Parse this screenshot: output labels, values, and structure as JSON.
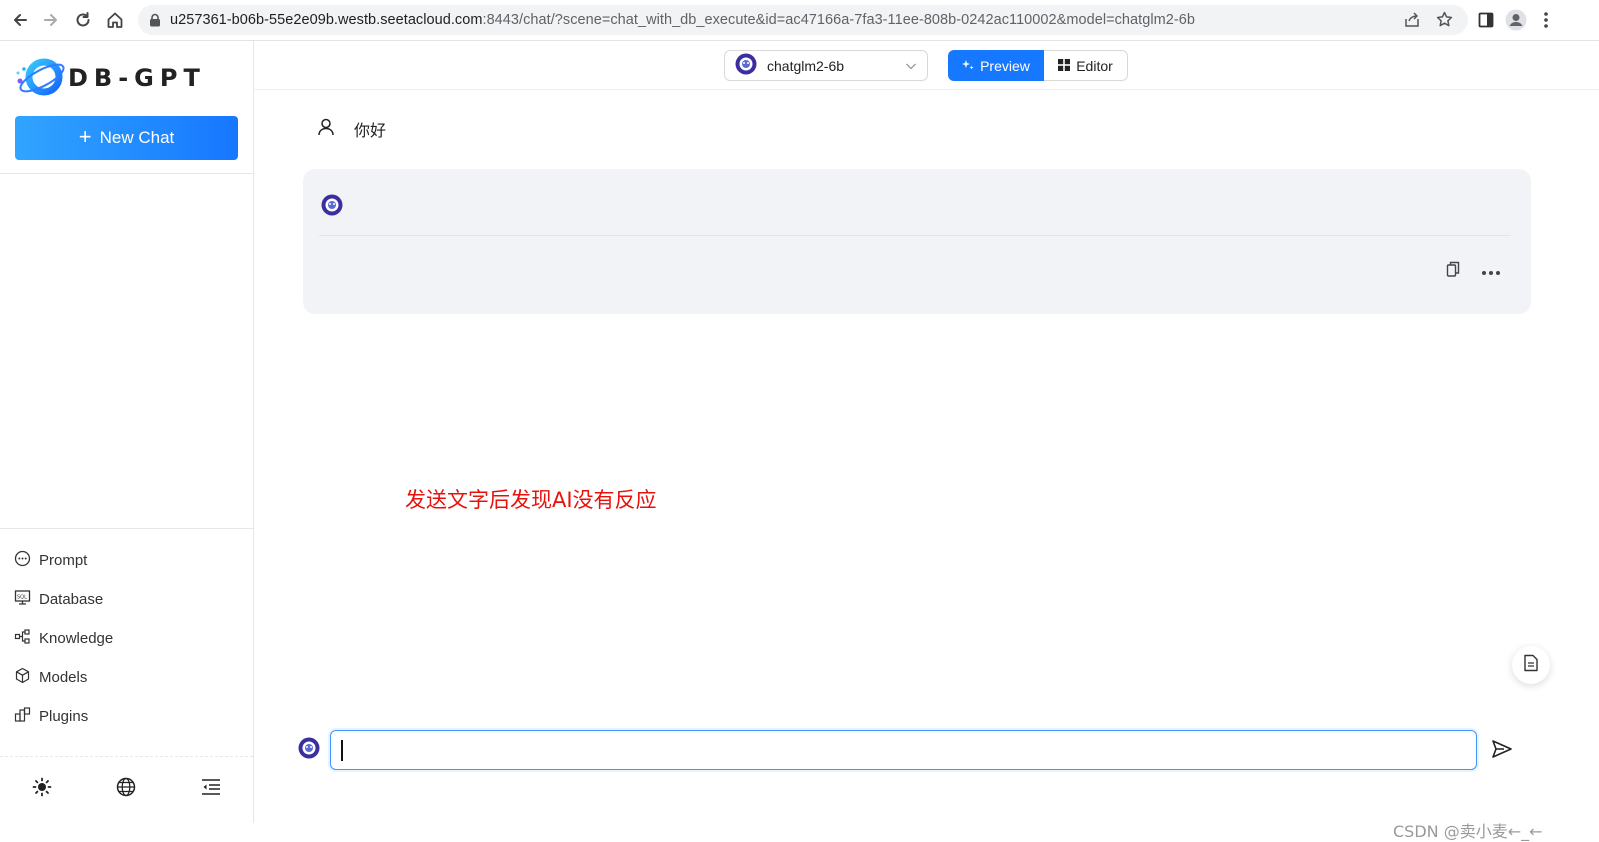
{
  "browser": {
    "url_host": "u257361-b06b-55e2e09b.westb.seetacloud.com",
    "url_path": ":8443/chat/?scene=chat_with_db_execute&id=ac47166a-7fa3-11ee-808b-0242ac110002&model=chatglm2-6b"
  },
  "sidebar": {
    "logo_text": "DB-GPT",
    "new_chat_label": "New Chat",
    "menu": [
      {
        "label": "Prompt",
        "icon": "chat-dots-icon"
      },
      {
        "label": "Database",
        "icon": "database-sql-icon"
      },
      {
        "label": "Knowledge",
        "icon": "knowledge-graph-icon"
      },
      {
        "label": "Models",
        "icon": "cube-icon"
      },
      {
        "label": "Plugins",
        "icon": "plugin-blocks-icon"
      }
    ],
    "footer": [
      "theme-sun-icon",
      "language-globe-icon",
      "collapse-menu-icon"
    ]
  },
  "topbar": {
    "model_name": "chatglm2-6b",
    "preview_label": "Preview",
    "editor_label": "Editor"
  },
  "conversation": {
    "user_message": "你好",
    "ai_message": ""
  },
  "annotation": "发送文字后发现AI没有反应",
  "input": {
    "value": "",
    "placeholder": ""
  },
  "watermark": "CSDN @卖小麦←_←",
  "colors": {
    "primary": "#1677ff",
    "card_bg": "#f1f3f7",
    "annotation": "#e8120c"
  }
}
